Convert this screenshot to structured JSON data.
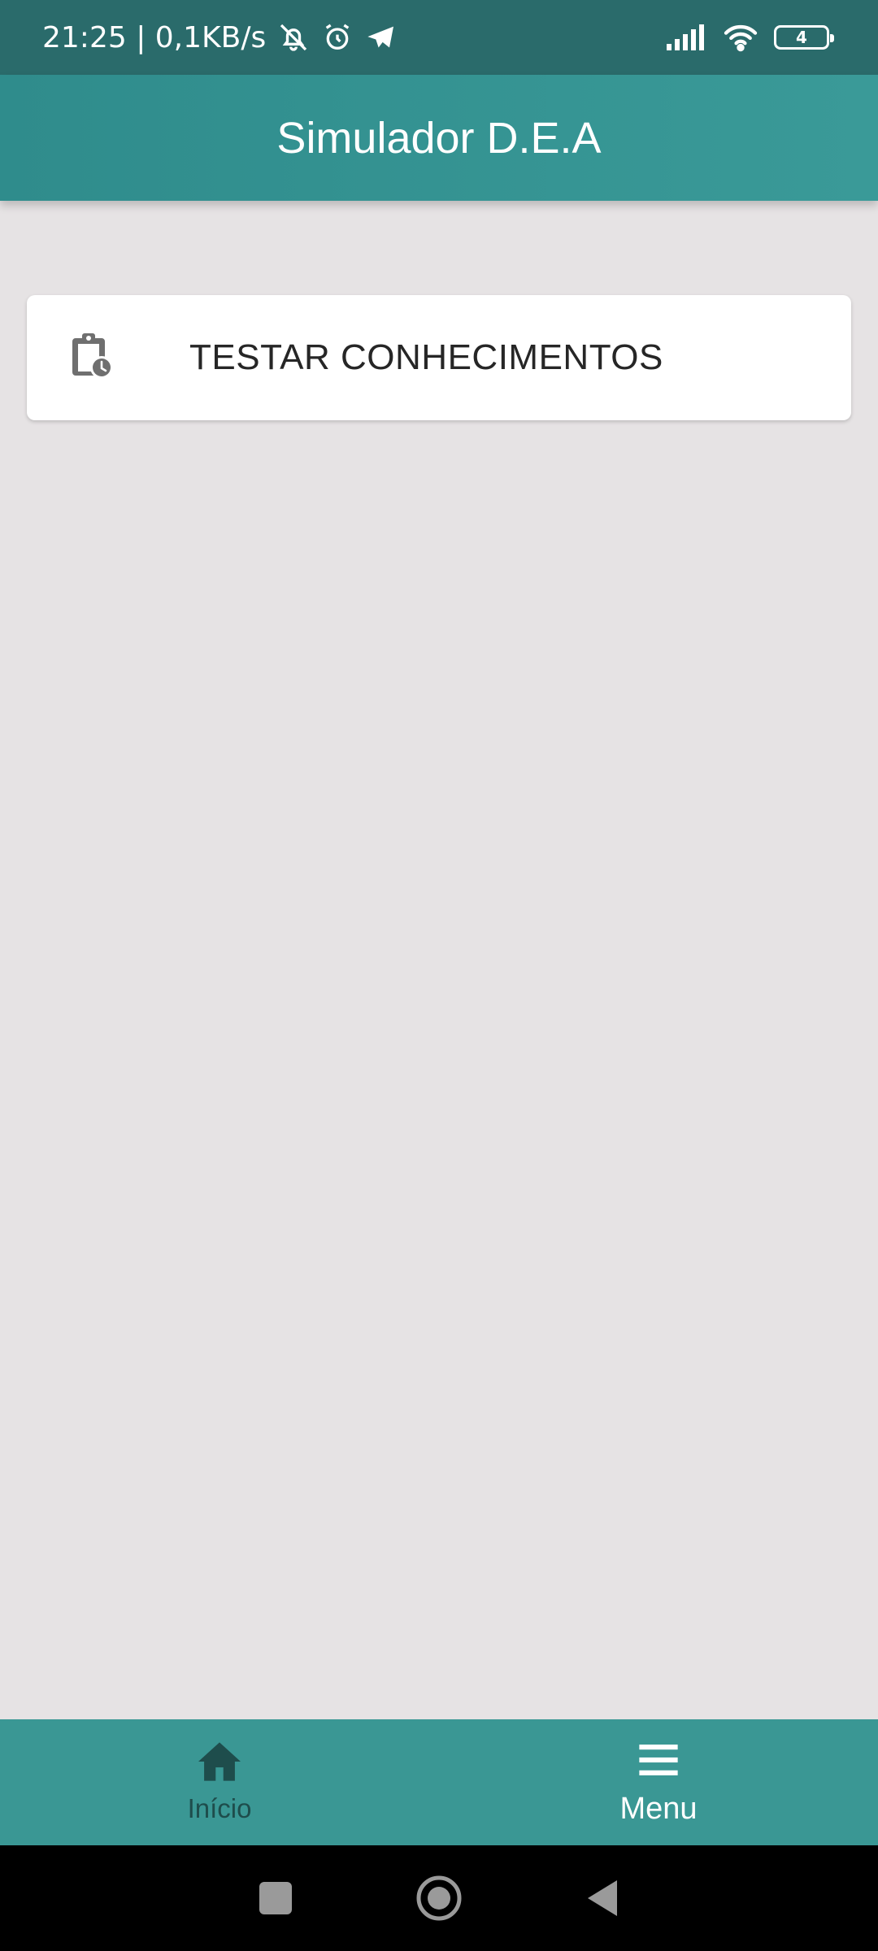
{
  "status_bar": {
    "time_speed": "21:25 | 0,1KB/s",
    "battery_level": "4",
    "icons": [
      "bell-off-icon",
      "alarm-icon",
      "telegram-icon",
      "signal-icon",
      "wifi-icon",
      "battery-icon"
    ]
  },
  "app_bar": {
    "title": "Simulador D.E.A"
  },
  "main": {
    "card": {
      "icon": "clipboard-clock-icon",
      "label": "TESTAR CONHECIMENTOS"
    }
  },
  "bottom_nav": {
    "items": [
      {
        "label": "Início",
        "icon": "home-icon"
      },
      {
        "label": "Menu",
        "icon": "menu-icon"
      }
    ]
  },
  "system_nav": {
    "buttons": [
      "recents-square-icon",
      "home-circle-icon",
      "back-triangle-icon"
    ]
  },
  "colors": {
    "status_bar": "#2a6b6b",
    "app_bar": "#3a9a98",
    "background": "#e6e3e4",
    "nav_bar": "#3a9794"
  }
}
